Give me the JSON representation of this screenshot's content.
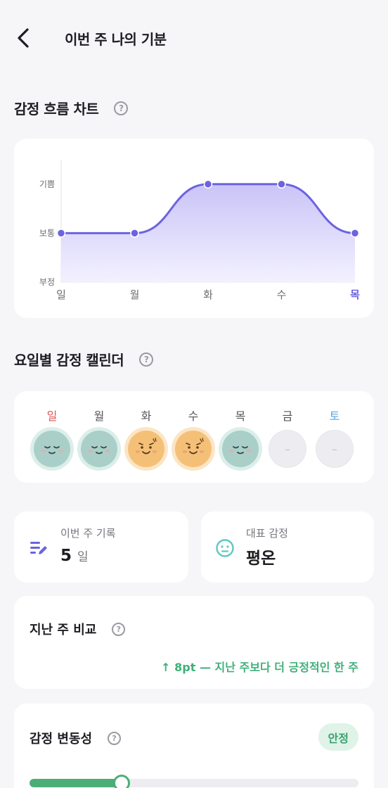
{
  "header": {
    "title": "이번 주 나의 기분"
  },
  "chart_section": {
    "title": "감정 흐름 차트",
    "help": "?"
  },
  "chart_data": {
    "type": "area",
    "categories": [
      "일",
      "월",
      "화",
      "수",
      "목"
    ],
    "values": [
      2,
      2,
      3,
      3,
      2
    ],
    "y_levels": [
      "부정",
      "보통",
      "기쁨"
    ],
    "ylim": [
      1,
      3.5
    ],
    "highlight_category": "목",
    "colors": {
      "line": "#6c63e0",
      "fill_top": "#c9c4f7",
      "fill_bottom": "#f3f1ff",
      "highlight": "#6c63e0"
    }
  },
  "calendar_section": {
    "title": "요일별 감정 캘린더",
    "help": "?",
    "days": [
      {
        "label": "일",
        "mood": "calm",
        "color": "#e0555a"
      },
      {
        "label": "월",
        "mood": "calm",
        "color": "#55555c"
      },
      {
        "label": "화",
        "mood": "happy",
        "color": "#55555c"
      },
      {
        "label": "수",
        "mood": "happy",
        "color": "#55555c"
      },
      {
        "label": "목",
        "mood": "calm",
        "color": "#55555c"
      },
      {
        "label": "금",
        "mood": "empty",
        "color": "#55555c"
      },
      {
        "label": "토",
        "mood": "empty",
        "color": "#5aa7e0"
      }
    ],
    "empty_symbol": "–"
  },
  "stats": {
    "record": {
      "label": "이번 주 기록",
      "value": "5",
      "unit": "일"
    },
    "emotion": {
      "label": "대표 감정",
      "value": "평온"
    }
  },
  "compare": {
    "title": "지난 주 비교",
    "help": "?",
    "result": "↑ 8pt — 지난 주보다 더 긍정적인 한 주",
    "color": "#3fb07a"
  },
  "variability": {
    "title": "감정 변동성",
    "help": "?",
    "badge": "안정",
    "level": 0.28,
    "colors": {
      "badge_bg": "#dff3e8",
      "badge_text": "#3aa06f",
      "bar_fill": "#4cae77",
      "track": "#ececf1"
    }
  }
}
